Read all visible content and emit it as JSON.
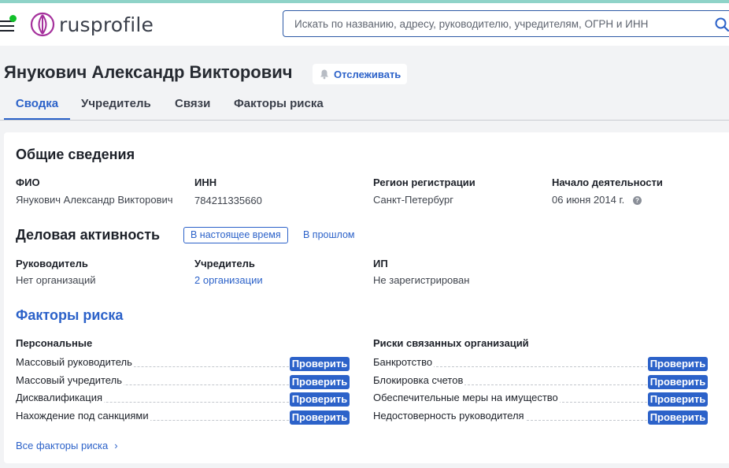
{
  "header": {
    "logo_text": "rusprofile",
    "search_placeholder": "Искать по названию, адресу, руководителю, учредителям, ОГРН и ИНН"
  },
  "person": {
    "name": "Янукович Александр Викторович",
    "track_label": "Отслеживать"
  },
  "tabs": [
    {
      "label": "Сводка",
      "active": true
    },
    {
      "label": "Учредитель",
      "active": false
    },
    {
      "label": "Связи",
      "active": false
    },
    {
      "label": "Факторы риска",
      "active": false
    }
  ],
  "general": {
    "title": "Общие сведения",
    "fields": [
      {
        "label": "ФИО",
        "value": "Янукович Александр Викторович"
      },
      {
        "label": "ИНН",
        "value": "784211335660"
      },
      {
        "label": "Регион регистрации",
        "value": "Санкт-Петербург"
      },
      {
        "label": "Начало деятельности",
        "value": "06 июня 2014 г."
      }
    ],
    "help_glyph": "?"
  },
  "business": {
    "title": "Деловая активность",
    "filter_current": "В настоящее время",
    "filter_past": "В прошлом",
    "fields": [
      {
        "label": "Руководитель",
        "value": "Нет организаций"
      },
      {
        "label": "Учредитель",
        "value": "2 организации"
      },
      {
        "label": "ИП",
        "value": "Не зарегистрирован"
      }
    ]
  },
  "risks": {
    "title": "Факторы риска",
    "personal_title": "Персональные",
    "related_title": "Риски связанных организаций",
    "check_label": "Проверить",
    "personal": [
      "Массовый руководитель",
      "Массовый учредитель",
      "Дисквалификация",
      "Нахождение под санкциями"
    ],
    "related": [
      "Банкротство",
      "Блокировка счетов",
      "Обеспечительные меры на имущество",
      "Недостоверность руководителя"
    ],
    "all_link": "Все факторы риска",
    "chevron": "›"
  },
  "colors": {
    "accent": "#2c62c9",
    "online_dot": "#11c02a"
  }
}
